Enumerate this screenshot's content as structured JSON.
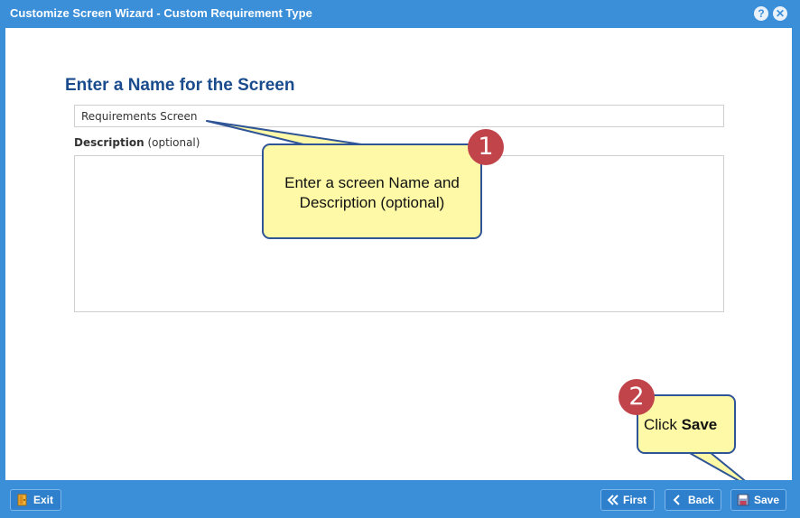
{
  "window": {
    "title": "Customize Screen Wizard - Custom Requirement Type",
    "help_glyph": "?",
    "close_glyph": "✕"
  },
  "form": {
    "heading": "Enter a Name for the Screen",
    "name_value": "Requirements Screen",
    "description_label": "Description",
    "description_optional": "(optional)",
    "description_value": ""
  },
  "callouts": {
    "step1_number": "1",
    "step1_text": "Enter a screen Name and Description (optional)",
    "step2_number": "2",
    "step2_prefix": "Click ",
    "step2_bold": "Save"
  },
  "footer": {
    "exit_label": "Exit",
    "first_label": "First",
    "back_label": "Back",
    "save_label": "Save"
  },
  "colors": {
    "chrome_blue": "#3b8fd9",
    "heading_navy": "#1a4b8c",
    "callout_fill": "#fdf9a6",
    "callout_border": "#2f5597",
    "badge_red": "#c0444a"
  }
}
